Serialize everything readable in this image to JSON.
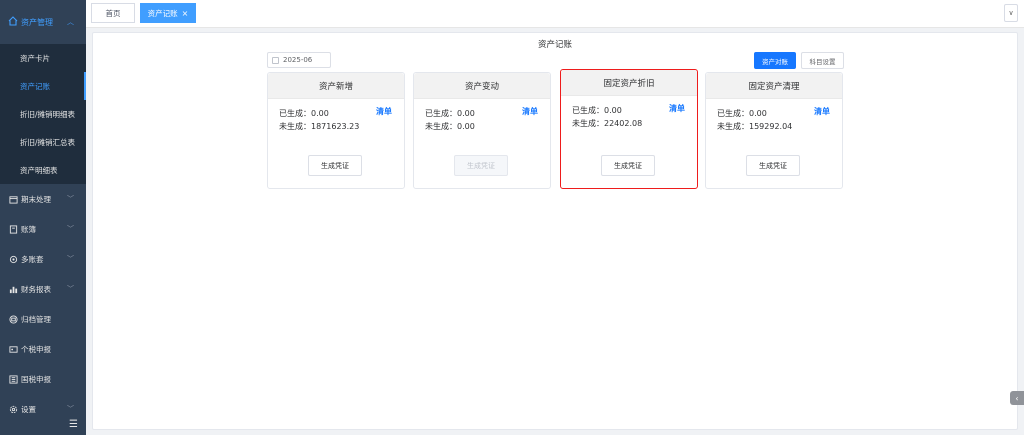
{
  "sidebar": {
    "asset_menu": "资产管理",
    "sub_items": [
      {
        "label": "资产卡片"
      },
      {
        "label": "资产记账"
      },
      {
        "label": "折旧/摊销明细表"
      },
      {
        "label": "折旧/摊销汇总表"
      },
      {
        "label": "资产明细表"
      }
    ],
    "menus": [
      {
        "label": "期末处理",
        "icon": "calendar-icon",
        "has_chevron": true
      },
      {
        "label": "账簿",
        "icon": "book-icon",
        "has_chevron": true
      },
      {
        "label": "多账套",
        "icon": "gear-icon",
        "has_chevron": true
      },
      {
        "label": "财务报表",
        "icon": "bar-chart-icon",
        "has_chevron": true
      },
      {
        "label": "归档管理",
        "icon": "archive-icon",
        "has_chevron": false
      },
      {
        "label": "个税申报",
        "icon": "id-card-icon",
        "has_chevron": false
      },
      {
        "label": "国税申报",
        "icon": "tax-icon",
        "has_chevron": false
      },
      {
        "label": "设置",
        "icon": "settings-icon",
        "has_chevron": true
      }
    ]
  },
  "tabs": {
    "home": "首页",
    "active": "资产记账",
    "close": "×"
  },
  "main": {
    "title": "资产记账",
    "period": "2025-06",
    "reconcile_button": "资产对账",
    "subject_settings_button": "科目设置",
    "generated_label": "已生成：",
    "pending_label": "未生成：",
    "list_link": "清单",
    "cards": [
      {
        "title": "资产新增",
        "generated": "0.00",
        "pending": "1871623.23",
        "has_list": true,
        "button": "生成凭证",
        "disabled": false
      },
      {
        "title": "资产变动",
        "generated": "0.00",
        "pending": "0.00",
        "has_list": true,
        "button": "生成凭证",
        "disabled": true
      },
      {
        "title": "固定资产折旧",
        "generated": "0.00",
        "pending": "22402.08",
        "has_list": true,
        "button": "生成凭证",
        "disabled": false,
        "highlighted": true
      },
      {
        "title": "固定资产清理",
        "generated": "0.00",
        "pending": "159292.04",
        "has_list": true,
        "button": "生成凭证",
        "disabled": false
      }
    ]
  },
  "colors": {
    "sidebar_bg": "#304156",
    "submenu_bg": "#1f2d3d",
    "accent": "#409eff",
    "primary_button": "#1677ff",
    "highlight_border": "#ee1c1c"
  }
}
